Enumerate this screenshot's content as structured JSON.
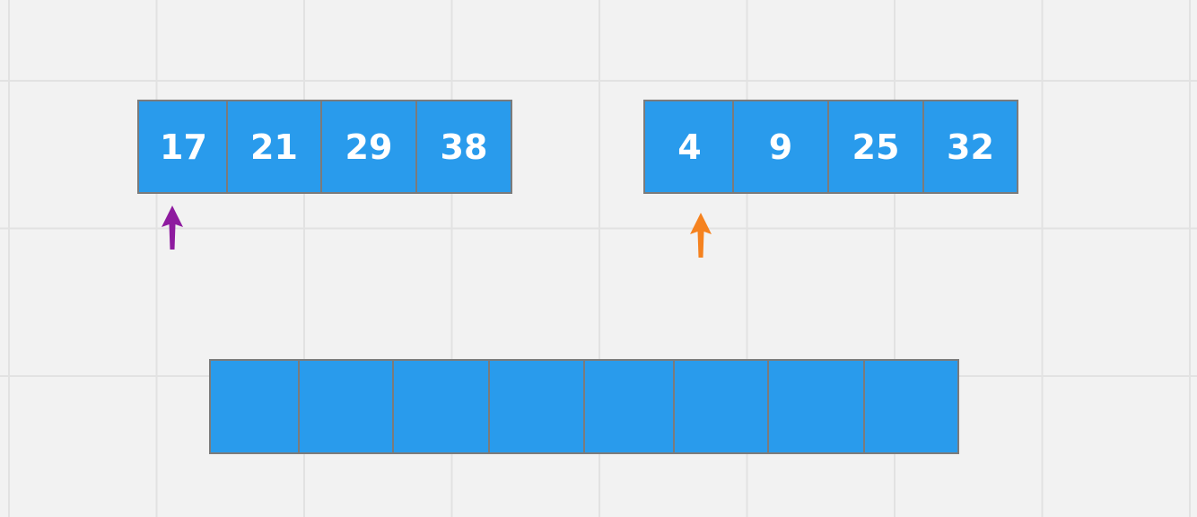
{
  "arrays": {
    "left": {
      "values": [
        "17",
        "21",
        "29",
        "38"
      ]
    },
    "right": {
      "values": [
        "4",
        "9",
        "25",
        "32"
      ]
    },
    "result": {
      "values": [
        "",
        "",
        "",
        "",
        "",
        "",
        "",
        ""
      ]
    }
  },
  "pointers": {
    "left_pointer": {
      "index": 0,
      "color": "#8e1b9f",
      "icon": "up-arrow-icon"
    },
    "right_pointer": {
      "index": 0,
      "color": "#f5821f",
      "icon": "up-arrow-icon"
    }
  },
  "colors": {
    "cell_fill": "#299bec",
    "cell_border": "#7b7b7b",
    "cell_text": "#ffffff",
    "background": "#f2f2f2",
    "grid": "#e2e2e2"
  }
}
